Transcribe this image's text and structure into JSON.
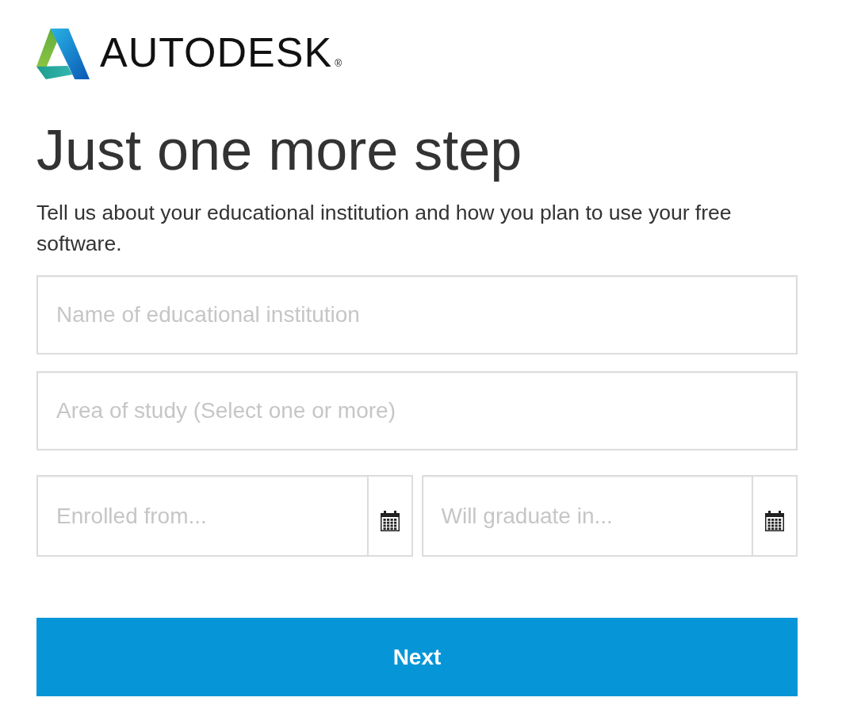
{
  "logo": {
    "wordmark": "AUTODESK",
    "registered_mark": "®"
  },
  "heading": "Just one more step",
  "intro": "Tell us about your educational institution and how you plan to use your free software.",
  "fields": [
    {
      "kind": "text",
      "placeholder": "Name of educational institution"
    },
    {
      "kind": "text",
      "placeholder": "Area of study (Select one or more)"
    },
    {
      "kind": "date",
      "placeholder": "Enrolled from..."
    },
    {
      "kind": "date",
      "placeholder": "Will graduate in..."
    }
  ],
  "next_button": "Next"
}
